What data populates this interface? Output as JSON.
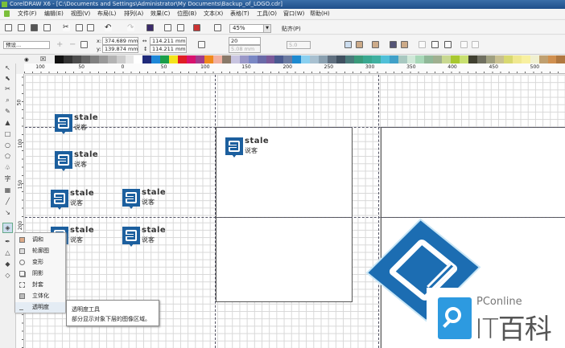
{
  "window": {
    "title": "CorelDRAW X6 - [C:\\Documents and Settings\\Administrator\\My Documents\\Backup_of_LOGO.cdr]"
  },
  "menu": [
    "文件(F)",
    "编辑(E)",
    "视图(V)",
    "布局(L)",
    "排列(A)",
    "效果(C)",
    "位图(B)",
    "文本(X)",
    "表格(T)",
    "工具(O)",
    "窗口(W)",
    "帮助(H)"
  ],
  "toolbar": {
    "zoom": "45%",
    "snap": "贴齐(P)"
  },
  "propbar": {
    "preset": "预设...",
    "x_label": "x:",
    "x": "374.689 mm",
    "y_label": "y:",
    "y": "139.874 mm",
    "width": "114.211 mm",
    "height": "114.211 mm",
    "steps": "20",
    "spacing": "5.08 mm",
    "accel": "5.0"
  },
  "palette": [
    "#111111",
    "#333333",
    "#4d4d4d",
    "#666666",
    "#808080",
    "#999999",
    "#b3b3b3",
    "#cccccc",
    "#e6e6e6",
    "#ffffff",
    "#1f2a7a",
    "#1e88d8",
    "#1a9e4a",
    "#f4e41c",
    "#e01e24",
    "#d8126e",
    "#a03c8c",
    "#f08a1c",
    "#f2b0a0",
    "#8a7a6a",
    "#c8c4e0",
    "#9a98c8",
    "#7a88c4",
    "#6a6aa8",
    "#7a5a9a",
    "#4a5a90",
    "#6a7aa0",
    "#1e8ad0",
    "#8ad0f0",
    "#a8c0d0",
    "#8aa0b0",
    "#607080",
    "#405060",
    "#4a7a7a",
    "#3a9a7a",
    "#3aa890",
    "#40b0a0",
    "#50c0d8",
    "#40a0c8",
    "#a8c8c0",
    "#d0e8d8",
    "#a8d8b8",
    "#90b898",
    "#a0b090",
    "#c8d890",
    "#a8c830",
    "#c8e070",
    "#404030",
    "#707060",
    "#a0a080",
    "#c8c090",
    "#d8d870",
    "#f0e890",
    "#f8f0a0",
    "#f0f0d0",
    "#c0a070",
    "#d09050",
    "#b07840"
  ],
  "hruler": [
    "100",
    "50",
    "0",
    "50",
    "100",
    "150",
    "200",
    "250",
    "300",
    "350",
    "400",
    "450",
    "500"
  ],
  "vruler": [
    "50",
    "100",
    "150",
    "200"
  ],
  "logo": {
    "en": "stale",
    "cn": "说客"
  },
  "flyout": [
    "调和",
    "轮廓图",
    "变形",
    "阴影",
    "封套",
    "立体化",
    "透明度"
  ],
  "tooltip": {
    "title": "透明度工具",
    "desc": "部分显示对象下层的图像区域。"
  },
  "watermark": {
    "brand": "PConline",
    "name": "IT百科"
  },
  "toolbox_text_tool": "字"
}
